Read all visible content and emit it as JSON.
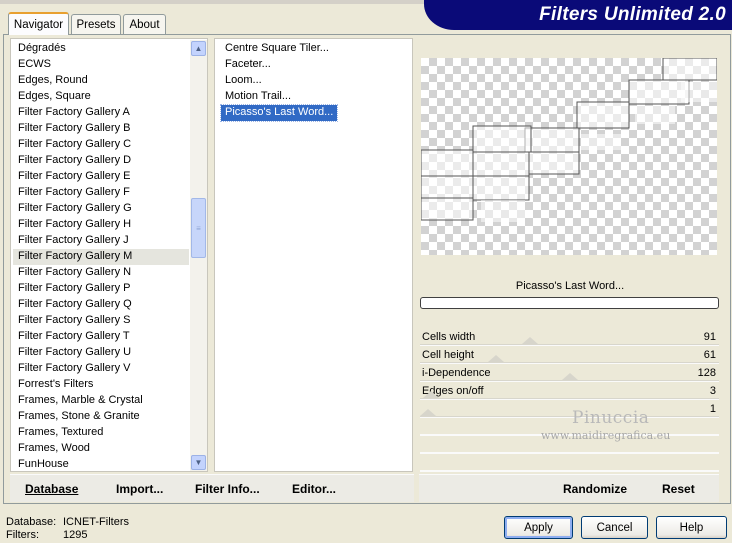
{
  "banner": {
    "title": "Filters Unlimited 2.0"
  },
  "tabs": [
    {
      "label": "Navigator",
      "active": true
    },
    {
      "label": "Presets",
      "active": false
    },
    {
      "label": "About",
      "active": false
    }
  ],
  "categories": {
    "items": [
      "Dégradés",
      "ECWS",
      "Edges, Round",
      "Edges, Square",
      "Filter Factory Gallery A",
      "Filter Factory Gallery B",
      "Filter Factory Gallery C",
      "Filter Factory Gallery D",
      "Filter Factory Gallery E",
      "Filter Factory Gallery F",
      "Filter Factory Gallery G",
      "Filter Factory Gallery H",
      "Filter Factory Gallery J",
      "Filter Factory Gallery M",
      "Filter Factory Gallery N",
      "Filter Factory Gallery P",
      "Filter Factory Gallery Q",
      "Filter Factory Gallery S",
      "Filter Factory Gallery T",
      "Filter Factory Gallery U",
      "Filter Factory Gallery V",
      "Forrest's Filters",
      "Frames, Marble & Crystal",
      "Frames, Stone & Granite",
      "Frames, Textured",
      "Frames, Wood",
      "FunHouse"
    ],
    "selected": "Filter Factory Gallery M"
  },
  "filters": {
    "items": [
      "Centre Square Tiler...",
      "Faceter...",
      "Loom...",
      "Motion Trail...",
      "Picasso's Last Word..."
    ],
    "selected": "Picasso's Last Word..."
  },
  "preview": {
    "filter_name": "Picasso's Last Word..."
  },
  "controls": [
    {
      "label": "Cells width",
      "value": "91",
      "level": 0.36
    },
    {
      "label": "Cell height",
      "value": "61",
      "level": 0.24
    },
    {
      "label": "i-Dependence",
      "value": "128",
      "level": 0.5
    },
    {
      "label": "Edges on/off",
      "value": "3",
      "level": 0.01
    },
    {
      "label": "",
      "value": "1",
      "level": 0.0
    }
  ],
  "watermark": {
    "name": "Pinuccia",
    "site": "www.maidiregrafica.eu"
  },
  "left_buttons": {
    "database": "Database",
    "import": "Import...",
    "filter_info": "Filter Info...",
    "editor": "Editor..."
  },
  "right_buttons": {
    "randomize": "Randomize",
    "reset": "Reset"
  },
  "status": {
    "database_label": "Database:",
    "database_value": "ICNET-Filters",
    "filters_label": "Filters:",
    "filters_value": "1295"
  },
  "dialog_buttons": {
    "apply": "Apply",
    "cancel": "Cancel",
    "help": "Help"
  },
  "colors": {
    "banner": "#0a0a78",
    "selection": "#316ac5",
    "tab_accent": "#e8a030"
  },
  "icons": {
    "scroll_up": "chevron-up-icon",
    "scroll_down": "chevron-down-icon",
    "scroll_grip": "grip-icon"
  }
}
